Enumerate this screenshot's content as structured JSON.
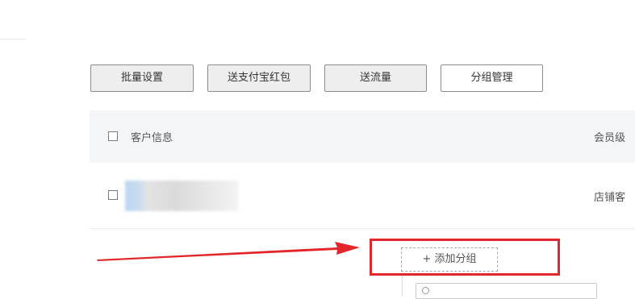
{
  "toolbar": {
    "batch_settings_label": "批量设置",
    "send_alipay_redpacket_label": "送支付宝红包",
    "send_data_label": "送流量",
    "group_manage_label": "分组管理"
  },
  "table": {
    "header": {
      "customer_info": "客户信息",
      "member_level": "会员级"
    },
    "rows": [
      {
        "level": "店铺客"
      }
    ]
  },
  "group_dropdown": {
    "add_group_label": "+ 添加分组",
    "search_icon": "search-icon"
  },
  "annotation": {
    "color": "#e2262a"
  }
}
